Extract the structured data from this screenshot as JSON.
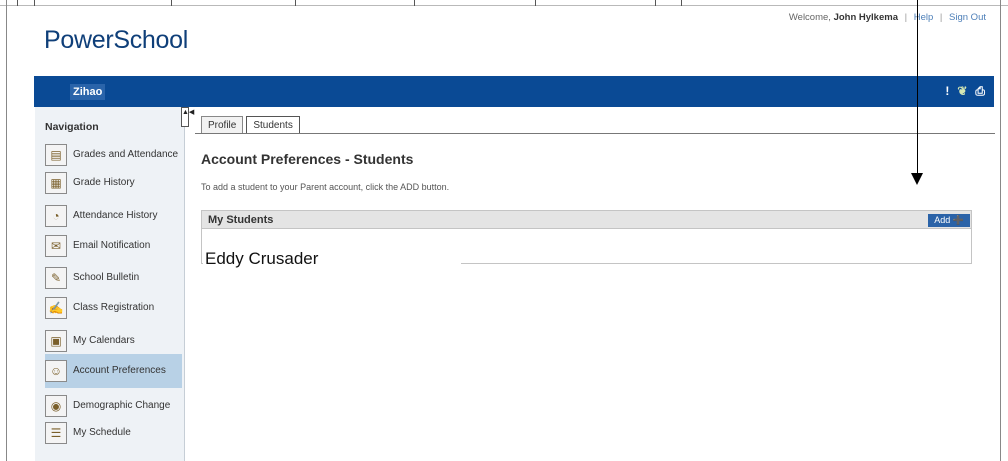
{
  "header": {
    "logo": "PowerSchool",
    "welcome_prefix": "Welcome,",
    "user_name": "John Hylkema",
    "help_label": "Help",
    "sign_out_label": "Sign Out",
    "separator": "|"
  },
  "bluebar": {
    "student_name": "Zihao",
    "alert_icon": "!",
    "print_icon": "⎙",
    "leaf_icon": "❦"
  },
  "sidebar": {
    "title": "Navigation",
    "collapse_icon": "▲◀",
    "items": [
      {
        "label": "Grades and Attendance",
        "icon": "▤"
      },
      {
        "label": "Grade History",
        "icon": "▦"
      },
      {
        "label": "Attendance History",
        "icon": "◔"
      },
      {
        "label": "Email Notification",
        "icon": "✉"
      },
      {
        "label": "School Bulletin",
        "icon": "✎"
      },
      {
        "label": "Class Registration",
        "icon": "✍"
      },
      {
        "label": "My Calendars",
        "icon": "▣"
      },
      {
        "label": "Account Preferences",
        "icon": "☺"
      },
      {
        "label": "Demographic Change",
        "icon": "◉"
      },
      {
        "label": "My Schedule",
        "icon": "☰"
      }
    ]
  },
  "tabs": [
    {
      "label": "Profile",
      "active": false
    },
    {
      "label": "Students",
      "active": true
    }
  ],
  "main": {
    "heading": "Account Preferences - Students",
    "instruction": "To add a student to your Parent account, click the ADD button.",
    "students_title": "My Students",
    "add_label": "Add ➕",
    "student_entry": "Eddy Crusader"
  },
  "colors": {
    "brand_blue": "#0a4a95",
    "logo_blue": "#0f3f79",
    "active_nav": "#b8d1e6"
  }
}
